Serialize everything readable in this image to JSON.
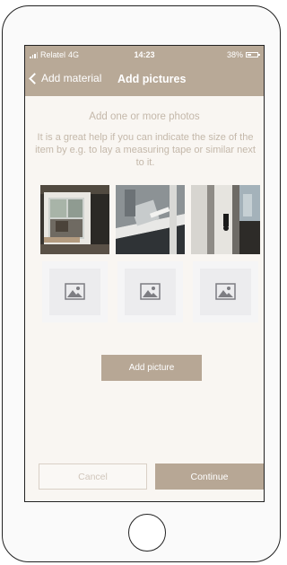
{
  "status_bar": {
    "carrier": "Relatel",
    "network": "4G",
    "time": "14:23",
    "battery": "38%",
    "battery_level": 0.38
  },
  "nav": {
    "back_label": "Add material",
    "title": "Add pictures"
  },
  "content": {
    "heading": "Add one or more photos",
    "help_text": "It is a great help if you can indicate the size of the item by e.g. to lay a measuring tape or similar next to it."
  },
  "photos": [
    {
      "kind": "photo",
      "subject": "open window with white frame"
    },
    {
      "kind": "photo",
      "subject": "window handle close-up"
    },
    {
      "kind": "photo",
      "subject": "window frame with hinge"
    },
    {
      "kind": "placeholder",
      "icon": "image-placeholder-icon"
    },
    {
      "kind": "placeholder",
      "icon": "image-placeholder-icon"
    },
    {
      "kind": "placeholder",
      "icon": "image-placeholder-icon"
    }
  ],
  "actions": {
    "add_picture_label": "Add picture",
    "cancel_label": "Cancel",
    "continue_label": "Continue"
  },
  "colors": {
    "header": "#b8a997",
    "accent": "#b7a795",
    "muted_text": "#c4b8aa",
    "background": "#f9f6f2"
  }
}
